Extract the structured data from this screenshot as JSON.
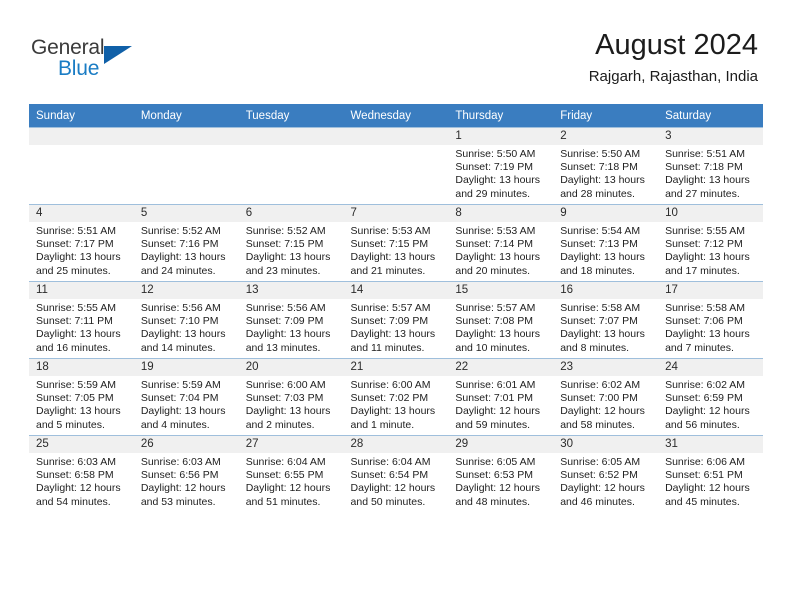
{
  "brand": {
    "name_part1": "General",
    "name_part2": "Blue",
    "logo_icon": "triangle-logo-icon",
    "accent_color": "#1060a8",
    "blue_text_color": "#1a7cc4"
  },
  "header": {
    "title": "August 2024",
    "location": "Rajgarh, Rajasthan, India"
  },
  "calendar": {
    "header_background": "#3a7dc0",
    "daynum_background": "#f0f0f0",
    "weekdays": [
      "Sunday",
      "Monday",
      "Tuesday",
      "Wednesday",
      "Thursday",
      "Friday",
      "Saturday"
    ],
    "weeks": [
      [
        {
          "day": "",
          "empty": true
        },
        {
          "day": "",
          "empty": true
        },
        {
          "day": "",
          "empty": true
        },
        {
          "day": "",
          "empty": true
        },
        {
          "day": "1",
          "sunrise": "Sunrise: 5:50 AM",
          "sunset": "Sunset: 7:19 PM",
          "daylight_line1": "Daylight: 13 hours",
          "daylight_line2": "and 29 minutes."
        },
        {
          "day": "2",
          "sunrise": "Sunrise: 5:50 AM",
          "sunset": "Sunset: 7:18 PM",
          "daylight_line1": "Daylight: 13 hours",
          "daylight_line2": "and 28 minutes."
        },
        {
          "day": "3",
          "sunrise": "Sunrise: 5:51 AM",
          "sunset": "Sunset: 7:18 PM",
          "daylight_line1": "Daylight: 13 hours",
          "daylight_line2": "and 27 minutes."
        }
      ],
      [
        {
          "day": "4",
          "sunrise": "Sunrise: 5:51 AM",
          "sunset": "Sunset: 7:17 PM",
          "daylight_line1": "Daylight: 13 hours",
          "daylight_line2": "and 25 minutes."
        },
        {
          "day": "5",
          "sunrise": "Sunrise: 5:52 AM",
          "sunset": "Sunset: 7:16 PM",
          "daylight_line1": "Daylight: 13 hours",
          "daylight_line2": "and 24 minutes."
        },
        {
          "day": "6",
          "sunrise": "Sunrise: 5:52 AM",
          "sunset": "Sunset: 7:15 PM",
          "daylight_line1": "Daylight: 13 hours",
          "daylight_line2": "and 23 minutes."
        },
        {
          "day": "7",
          "sunrise": "Sunrise: 5:53 AM",
          "sunset": "Sunset: 7:15 PM",
          "daylight_line1": "Daylight: 13 hours",
          "daylight_line2": "and 21 minutes."
        },
        {
          "day": "8",
          "sunrise": "Sunrise: 5:53 AM",
          "sunset": "Sunset: 7:14 PM",
          "daylight_line1": "Daylight: 13 hours",
          "daylight_line2": "and 20 minutes."
        },
        {
          "day": "9",
          "sunrise": "Sunrise: 5:54 AM",
          "sunset": "Sunset: 7:13 PM",
          "daylight_line1": "Daylight: 13 hours",
          "daylight_line2": "and 18 minutes."
        },
        {
          "day": "10",
          "sunrise": "Sunrise: 5:55 AM",
          "sunset": "Sunset: 7:12 PM",
          "daylight_line1": "Daylight: 13 hours",
          "daylight_line2": "and 17 minutes."
        }
      ],
      [
        {
          "day": "11",
          "sunrise": "Sunrise: 5:55 AM",
          "sunset": "Sunset: 7:11 PM",
          "daylight_line1": "Daylight: 13 hours",
          "daylight_line2": "and 16 minutes."
        },
        {
          "day": "12",
          "sunrise": "Sunrise: 5:56 AM",
          "sunset": "Sunset: 7:10 PM",
          "daylight_line1": "Daylight: 13 hours",
          "daylight_line2": "and 14 minutes."
        },
        {
          "day": "13",
          "sunrise": "Sunrise: 5:56 AM",
          "sunset": "Sunset: 7:09 PM",
          "daylight_line1": "Daylight: 13 hours",
          "daylight_line2": "and 13 minutes."
        },
        {
          "day": "14",
          "sunrise": "Sunrise: 5:57 AM",
          "sunset": "Sunset: 7:09 PM",
          "daylight_line1": "Daylight: 13 hours",
          "daylight_line2": "and 11 minutes."
        },
        {
          "day": "15",
          "sunrise": "Sunrise: 5:57 AM",
          "sunset": "Sunset: 7:08 PM",
          "daylight_line1": "Daylight: 13 hours",
          "daylight_line2": "and 10 minutes."
        },
        {
          "day": "16",
          "sunrise": "Sunrise: 5:58 AM",
          "sunset": "Sunset: 7:07 PM",
          "daylight_line1": "Daylight: 13 hours",
          "daylight_line2": "and 8 minutes."
        },
        {
          "day": "17",
          "sunrise": "Sunrise: 5:58 AM",
          "sunset": "Sunset: 7:06 PM",
          "daylight_line1": "Daylight: 13 hours",
          "daylight_line2": "and 7 minutes."
        }
      ],
      [
        {
          "day": "18",
          "sunrise": "Sunrise: 5:59 AM",
          "sunset": "Sunset: 7:05 PM",
          "daylight_line1": "Daylight: 13 hours",
          "daylight_line2": "and 5 minutes."
        },
        {
          "day": "19",
          "sunrise": "Sunrise: 5:59 AM",
          "sunset": "Sunset: 7:04 PM",
          "daylight_line1": "Daylight: 13 hours",
          "daylight_line2": "and 4 minutes."
        },
        {
          "day": "20",
          "sunrise": "Sunrise: 6:00 AM",
          "sunset": "Sunset: 7:03 PM",
          "daylight_line1": "Daylight: 13 hours",
          "daylight_line2": "and 2 minutes."
        },
        {
          "day": "21",
          "sunrise": "Sunrise: 6:00 AM",
          "sunset": "Sunset: 7:02 PM",
          "daylight_line1": "Daylight: 13 hours",
          "daylight_line2": "and 1 minute."
        },
        {
          "day": "22",
          "sunrise": "Sunrise: 6:01 AM",
          "sunset": "Sunset: 7:01 PM",
          "daylight_line1": "Daylight: 12 hours",
          "daylight_line2": "and 59 minutes."
        },
        {
          "day": "23",
          "sunrise": "Sunrise: 6:02 AM",
          "sunset": "Sunset: 7:00 PM",
          "daylight_line1": "Daylight: 12 hours",
          "daylight_line2": "and 58 minutes."
        },
        {
          "day": "24",
          "sunrise": "Sunrise: 6:02 AM",
          "sunset": "Sunset: 6:59 PM",
          "daylight_line1": "Daylight: 12 hours",
          "daylight_line2": "and 56 minutes."
        }
      ],
      [
        {
          "day": "25",
          "sunrise": "Sunrise: 6:03 AM",
          "sunset": "Sunset: 6:58 PM",
          "daylight_line1": "Daylight: 12 hours",
          "daylight_line2": "and 54 minutes."
        },
        {
          "day": "26",
          "sunrise": "Sunrise: 6:03 AM",
          "sunset": "Sunset: 6:56 PM",
          "daylight_line1": "Daylight: 12 hours",
          "daylight_line2": "and 53 minutes."
        },
        {
          "day": "27",
          "sunrise": "Sunrise: 6:04 AM",
          "sunset": "Sunset: 6:55 PM",
          "daylight_line1": "Daylight: 12 hours",
          "daylight_line2": "and 51 minutes."
        },
        {
          "day": "28",
          "sunrise": "Sunrise: 6:04 AM",
          "sunset": "Sunset: 6:54 PM",
          "daylight_line1": "Daylight: 12 hours",
          "daylight_line2": "and 50 minutes."
        },
        {
          "day": "29",
          "sunrise": "Sunrise: 6:05 AM",
          "sunset": "Sunset: 6:53 PM",
          "daylight_line1": "Daylight: 12 hours",
          "daylight_line2": "and 48 minutes."
        },
        {
          "day": "30",
          "sunrise": "Sunrise: 6:05 AM",
          "sunset": "Sunset: 6:52 PM",
          "daylight_line1": "Daylight: 12 hours",
          "daylight_line2": "and 46 minutes."
        },
        {
          "day": "31",
          "sunrise": "Sunrise: 6:06 AM",
          "sunset": "Sunset: 6:51 PM",
          "daylight_line1": "Daylight: 12 hours",
          "daylight_line2": "and 45 minutes."
        }
      ]
    ]
  }
}
